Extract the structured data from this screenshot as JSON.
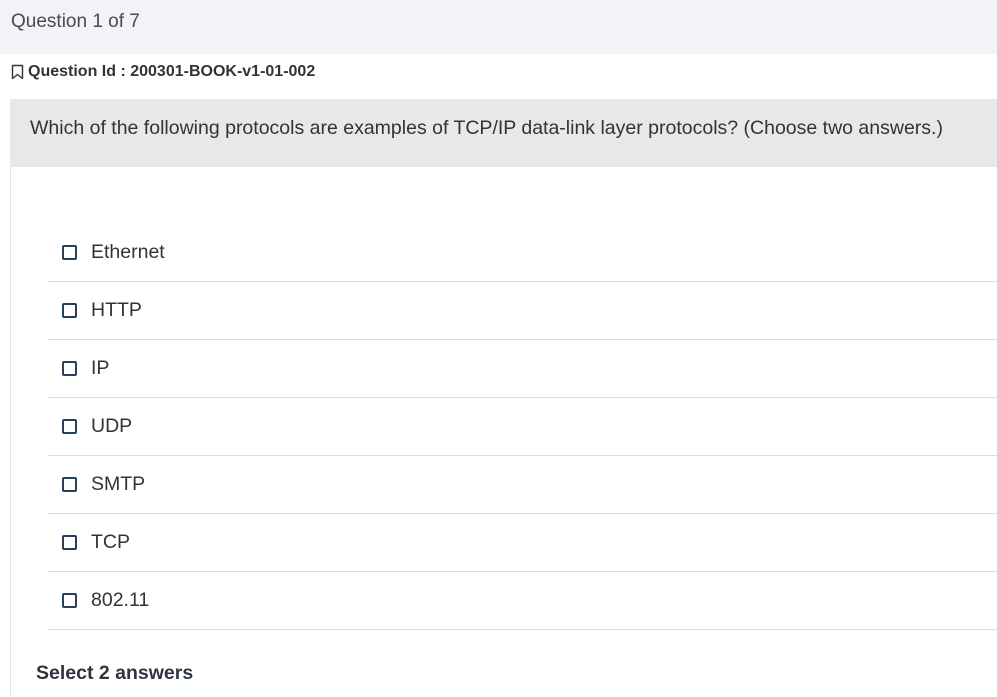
{
  "header": {
    "title": "Question 1 of 7"
  },
  "question": {
    "id_label": "Question Id : 200301-BOOK-v1-01-002",
    "text": "Which of the following protocols are examples of TCP/IP data-link layer protocols? (Choose two answers.)",
    "options": [
      {
        "label": "Ethernet",
        "checked": false
      },
      {
        "label": "HTTP",
        "checked": false
      },
      {
        "label": "IP",
        "checked": false
      },
      {
        "label": "UDP",
        "checked": false
      },
      {
        "label": "SMTP",
        "checked": false
      },
      {
        "label": "TCP",
        "checked": false
      },
      {
        "label": "802.11",
        "checked": false
      }
    ],
    "hint": "Select 2 answers"
  },
  "icons": {
    "bookmark": "bookmark-icon",
    "checkbox": "checkbox-unchecked-icon"
  },
  "colors": {
    "header_bg": "#f2f3f8",
    "question_bg": "#e8e8e8",
    "checkbox_border": "#2a3f5a"
  }
}
